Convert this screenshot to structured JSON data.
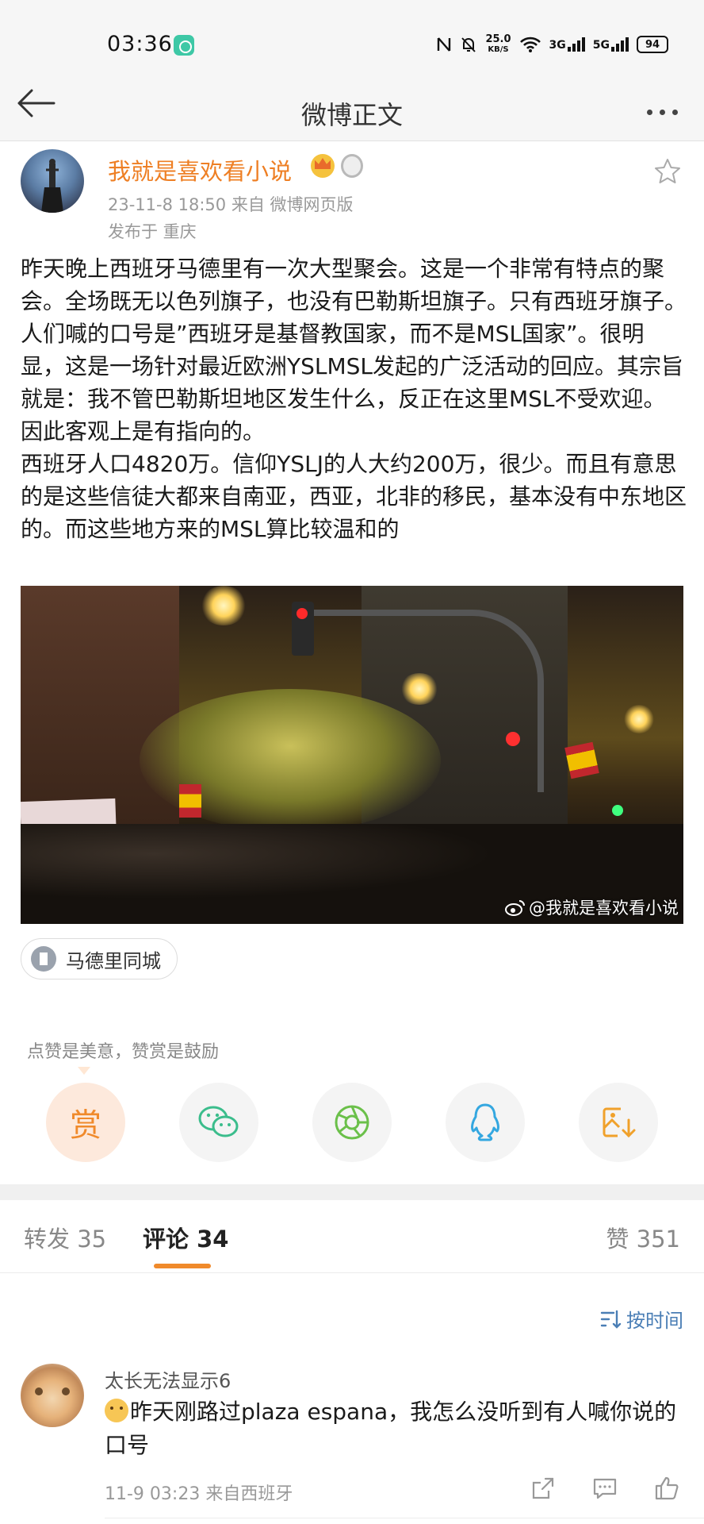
{
  "status_bar": {
    "time": "03:36",
    "net_speed_value": "25.0",
    "net_speed_unit": "KB/S",
    "sim1": "3G",
    "sim2": "5G",
    "battery": "94"
  },
  "nav": {
    "title": "微博正文"
  },
  "post": {
    "author": "我就是喜欢看小说",
    "meta": "23-11-8 18:50   来自 微博网页版",
    "location": "发布于 重庆",
    "paragraphs": [
      "昨天晚上西班牙马德里有一次大型聚会。这是一个非常有特点的聚会。全场既无以色列旗子，也没有巴勒斯坦旗子。只有西班牙旗子。",
      "人们喊的口号是”西班牙是基督教国家，而不是MSL国家”。很明显，这是一场针对最近欧洲YSLMSL发起的广泛活动的回应。其宗旨就是：我不管巴勒斯坦地区发生什么，反正在这里MSL不受欢迎。因此客观上是有指向的。",
      "西班牙人口4820万。信仰YSLJ的人大约200万，很少。而且有意思的是这些信徒大都来自南亚，西亚，北非的移民，基本没有中东地区的。而这些地方来的MSL算比较温和的"
    ],
    "video_watermark": "@我就是喜欢看小说",
    "topic": "马德里同城"
  },
  "reward": {
    "hint": "点赞是美意，赞赏是鼓励",
    "reward_char": "赏"
  },
  "tabs": {
    "repost": "转发 35",
    "comments": "评论 34",
    "likes": "赞 351"
  },
  "sort": {
    "label": "按时间"
  },
  "comment": {
    "user": "太长无法显示6",
    "text": "昨天刚路过plaza espana，我怎么没听到有人喊你说的口号",
    "meta": "11-9 03:23  来自西班牙"
  },
  "colors": {
    "accent_orange": "#f08a2b",
    "author_orange": "#ee7f24",
    "link_blue": "#4a7eb5",
    "wechat_green": "#3bbd8c",
    "moments_green": "#6bc04a",
    "qq_blue": "#34a7e0",
    "save_orange": "#f0a12b"
  }
}
